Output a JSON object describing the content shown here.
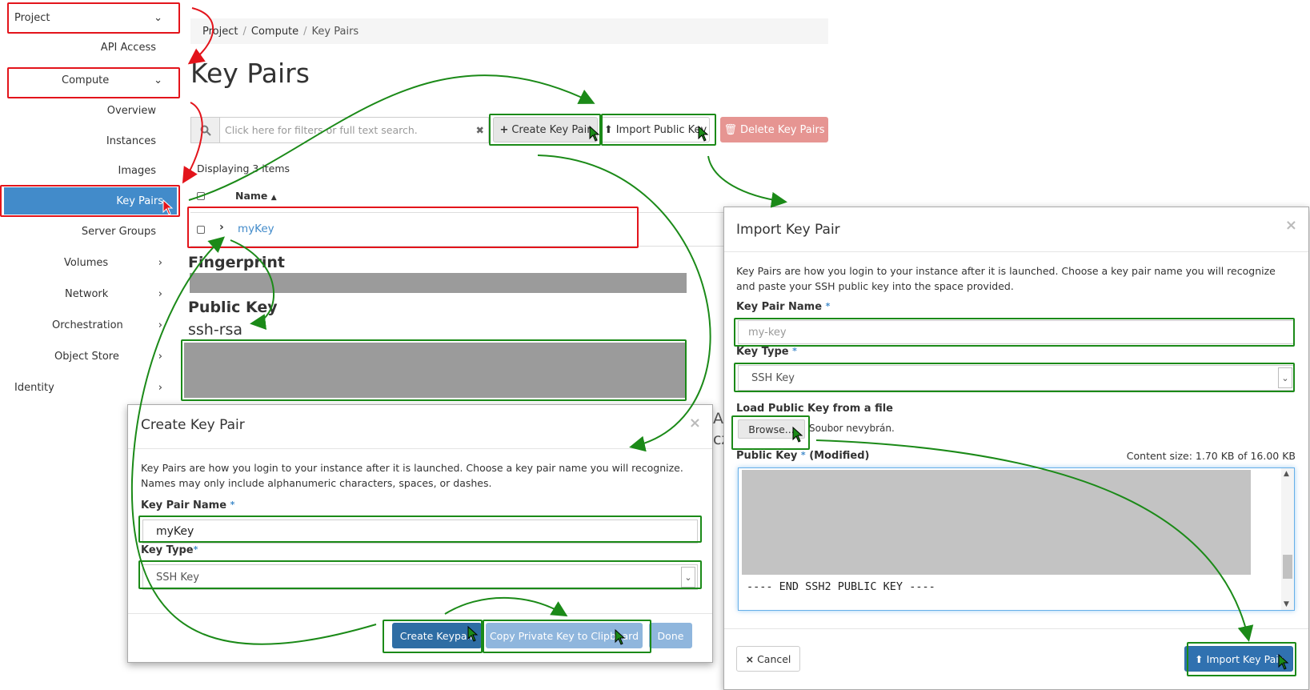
{
  "sidebar": {
    "project": "Project",
    "api_access": "API Access",
    "compute": "Compute",
    "overview": "Overview",
    "instances": "Instances",
    "images": "Images",
    "key_pairs": "Key Pairs",
    "server_groups": "Server Groups",
    "volumes": "Volumes",
    "network": "Network",
    "orchestration": "Orchestration",
    "object_store": "Object Store",
    "identity": "Identity"
  },
  "breadcrumb": {
    "project": "Project",
    "compute": "Compute",
    "current": "Key Pairs"
  },
  "page": {
    "title": "Key Pairs",
    "search_placeholder": "Click here for filters or full text search.",
    "create_btn": "Create Key Pair",
    "import_btn": "Import Public Key",
    "delete_btn": "Delete Key Pairs",
    "displaying": "Displaying 3 items",
    "col_name": "Name",
    "row_name": "myKey",
    "fingerprint_label": "Fingerprint",
    "public_key_label": "Public Key",
    "public_key_prefix": "ssh-rsa"
  },
  "create_modal": {
    "title": "Create Key Pair",
    "help": "Key Pairs are how you login to your instance after it is launched. Choose a key pair name you will recognize. Names may only include alphanumeric characters, spaces, or dashes.",
    "name_label": "Key Pair Name",
    "name_value": "myKey",
    "type_label": "Key Type",
    "type_value": "SSH Key",
    "create_btn": "Create Keypair",
    "copy_btn": "Copy Private Key to Clipboard",
    "done_btn": "Done",
    "behind_1": "A",
    "behind_2": "cz"
  },
  "import_modal": {
    "title": "Import Key Pair",
    "help": "Key Pairs are how you login to your instance after it is launched. Choose a key pair name you will recognize and paste your SSH public key into the space provided.",
    "name_label": "Key Pair Name",
    "name_placeholder": "my-key",
    "type_label": "Key Type",
    "type_value": "SSH Key",
    "file_label": "Load Public Key from a file",
    "browse_btn": "Browse...",
    "no_file": "Soubor nevybrán.",
    "pubkey_label": "Public Key",
    "modified": "(Modified)",
    "content_size": "Content size: 1.70 KB of 16.00 KB",
    "pubkey_end": "---- END SSH2 PUBLIC KEY ----",
    "cancel_btn": "Cancel",
    "import_btn": "Import Key Pair"
  },
  "colors": {
    "accent": "#428bca",
    "annotation_red": "#e3141b",
    "annotation_green": "#1b8a18"
  }
}
